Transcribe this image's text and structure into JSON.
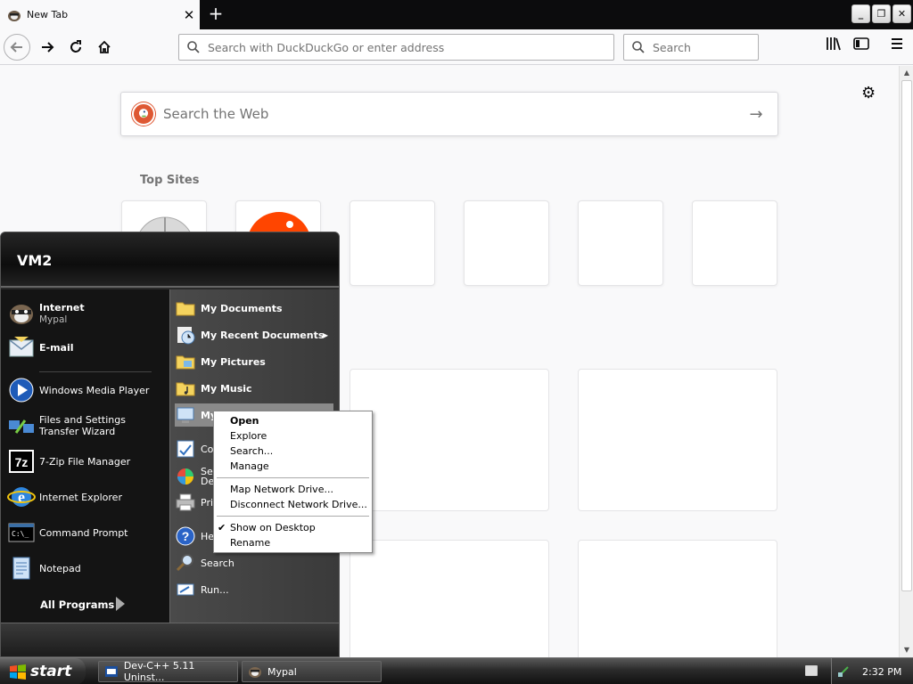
{
  "browser": {
    "tab_title": "New Tab",
    "new_tab_label": "+",
    "url_placeholder": "Search with DuckDuckGo or enter address",
    "search_placeholder": "Search"
  },
  "newtab": {
    "web_search_placeholder": "Search the Web",
    "top_sites_label": "Top Sites"
  },
  "startmenu": {
    "user": "VM2",
    "pinned": [
      {
        "label": "Internet",
        "sub": "Mypal"
      },
      {
        "label": "E-mail",
        "sub": ""
      }
    ],
    "recent": [
      {
        "label": "Windows Media Player"
      },
      {
        "label": "Files and Settings Transfer Wizard"
      },
      {
        "label": "7-Zip File Manager"
      },
      {
        "label": "Internet Explorer"
      },
      {
        "label": "Command Prompt"
      },
      {
        "label": "Notepad"
      }
    ],
    "all_programs": "All Programs",
    "places": [
      {
        "label": "My Documents"
      },
      {
        "label": "My Recent Documents"
      },
      {
        "label": "My Pictures"
      },
      {
        "label": "My Music"
      },
      {
        "label": "My"
      },
      {
        "label": "Co"
      },
      {
        "label": "Set\nDe"
      },
      {
        "label": "Pri"
      },
      {
        "label": "He"
      },
      {
        "label": "Search"
      },
      {
        "label": "Run..."
      }
    ]
  },
  "context_menu": {
    "items": [
      {
        "label": "Open",
        "bold": true
      },
      {
        "label": "Explore"
      },
      {
        "label": "Search..."
      },
      {
        "label": "Manage"
      },
      {
        "label": "Map Network Drive..."
      },
      {
        "label": "Disconnect Network Drive..."
      },
      {
        "label": "Show on Desktop",
        "checked": true
      },
      {
        "label": "Rename"
      }
    ]
  },
  "taskbar": {
    "start_label": "start",
    "tasks": [
      {
        "label": "Dev-C++ 5.11 Uninst..."
      },
      {
        "label": "Mypal"
      }
    ],
    "clock": "2:32 PM"
  },
  "colors": {
    "ddg": "#de5833",
    "start_menu_bg": "#141414",
    "taskbar": "#2b2b2b"
  }
}
